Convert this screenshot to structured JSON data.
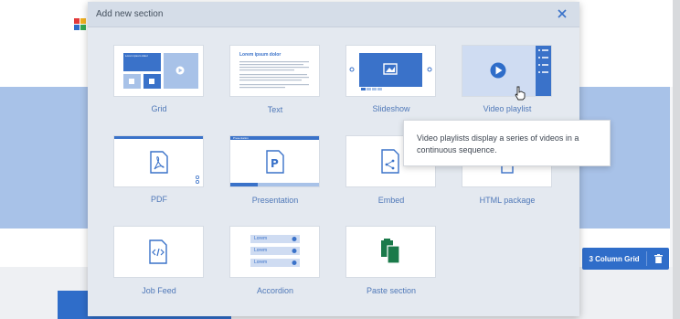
{
  "modal": {
    "title": "Add new section",
    "close_icon": "close-icon"
  },
  "tiles": [
    {
      "id": "grid",
      "label": "Grid"
    },
    {
      "id": "text",
      "label": "Text"
    },
    {
      "id": "slideshow",
      "label": "Slideshow"
    },
    {
      "id": "video-playlist",
      "label": "Video playlist"
    },
    {
      "id": "pdf",
      "label": "PDF"
    },
    {
      "id": "presentation",
      "label": "Presentation"
    },
    {
      "id": "embed",
      "label": "Embed"
    },
    {
      "id": "html-package",
      "label": "HTML package"
    },
    {
      "id": "job-feed",
      "label": "Job Feed"
    },
    {
      "id": "accordion",
      "label": "Accordion"
    },
    {
      "id": "paste-section",
      "label": "Paste section"
    }
  ],
  "previews": {
    "grid_heading": "Lorem ipsum dolor",
    "text_heading": "Lorem ipsum dolor",
    "presentation_bar": "Presentation",
    "accordion_items": [
      "Lorem",
      "Lorem",
      "Lorem"
    ]
  },
  "tooltip": {
    "text": "Video playlists display a series of videos in a continuous sequence."
  },
  "toolbar": {
    "grid_label": "3 Column Grid"
  },
  "colors": {
    "accent": "#2f6dc9",
    "label": "#4f78b8",
    "paste_green": "#1a7a4a"
  }
}
